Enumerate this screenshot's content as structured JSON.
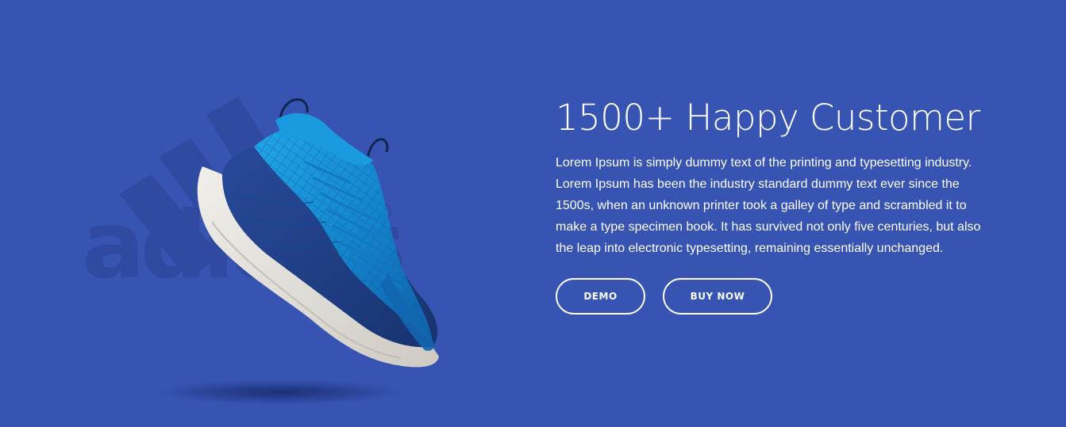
{
  "hero": {
    "headline": "1500+ Happy Customer",
    "description": "Lorem Ipsum is simply dummy text of the printing and typesetting industry. Lorem Ipsum has been the industry standard dummy text ever since the 1500s, when an unknown printer took a galley of type and scrambled it to make a type specimen book. It has survived not only five centuries, but also the leap into electronic typesetting, remaining essentially unchanged.",
    "buttons": {
      "demo_label": "DEMO",
      "buy_label": "BUY NOW"
    },
    "logo_watermark": "adidas",
    "colors": {
      "background": "#3754b3",
      "shoe_primary": "#1a8fd6",
      "shoe_dark": "#1e3f86",
      "sole": "#e7e4df"
    },
    "icons": [
      "adidas-logo-watermark",
      "sneaker-product-image"
    ]
  }
}
